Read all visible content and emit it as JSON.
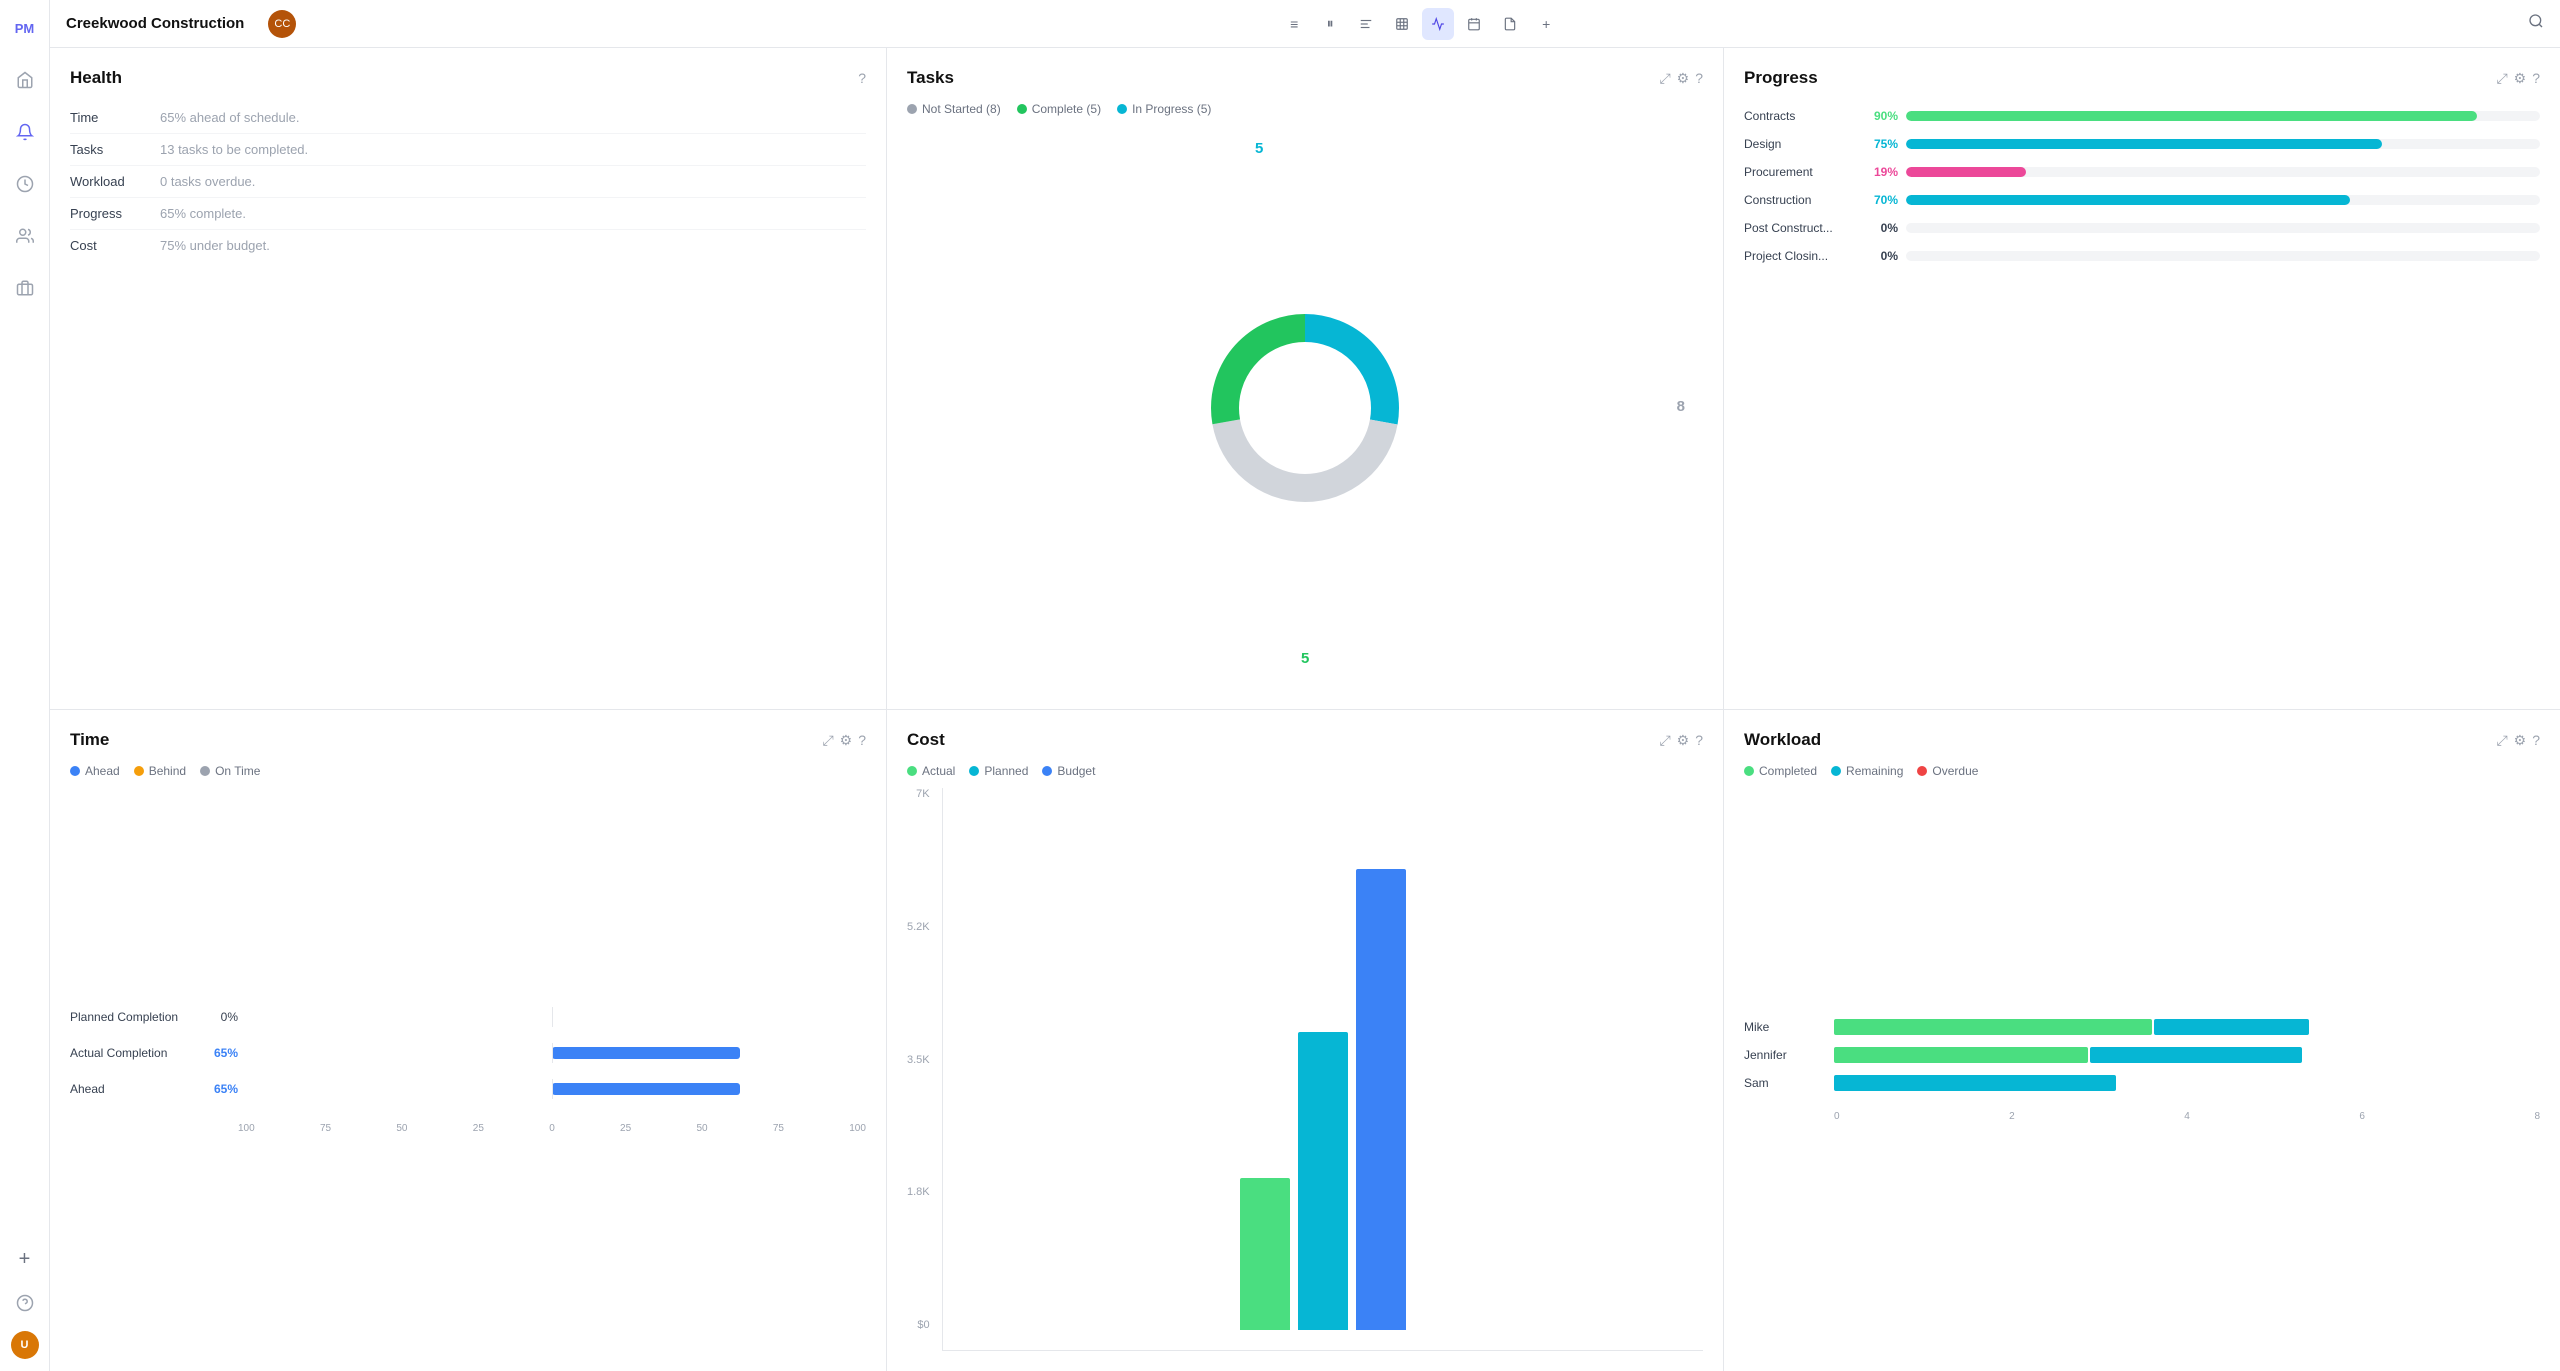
{
  "app": {
    "name": "PM",
    "project": "Creekwood Construction"
  },
  "topbar": {
    "icons": [
      {
        "label": "≡",
        "name": "list-icon",
        "active": false
      },
      {
        "label": "⏸",
        "name": "column-icon",
        "active": false
      },
      {
        "label": "≡",
        "name": "gantt-icon",
        "active": false
      },
      {
        "label": "▦",
        "name": "grid-icon",
        "active": false
      },
      {
        "label": "∿",
        "name": "dashboard-icon",
        "active": true
      },
      {
        "label": "⊞",
        "name": "calendar-icon",
        "active": false
      },
      {
        "label": "⎘",
        "name": "doc-icon",
        "active": false
      },
      {
        "label": "+",
        "name": "add-view-icon",
        "active": false
      }
    ]
  },
  "health": {
    "title": "Health",
    "rows": [
      {
        "label": "Time",
        "value": "65% ahead of schedule."
      },
      {
        "label": "Tasks",
        "value": "13 tasks to be completed."
      },
      {
        "label": "Workload",
        "value": "0 tasks overdue."
      },
      {
        "label": "Progress",
        "value": "65% complete."
      },
      {
        "label": "Cost",
        "value": "75% under budget."
      }
    ]
  },
  "tasks": {
    "title": "Tasks",
    "legend": [
      {
        "label": "Not Started (8)",
        "color": "#9ca3af"
      },
      {
        "label": "Complete (5)",
        "color": "#22c55e"
      },
      {
        "label": "In Progress (5)",
        "color": "#06b6d4"
      }
    ],
    "donut": {
      "not_started": 8,
      "complete": 5,
      "in_progress": 5,
      "label_5_top": "5",
      "label_8_right": "8",
      "label_5_bottom": "5"
    }
  },
  "progress": {
    "title": "Progress",
    "rows": [
      {
        "label": "Contracts",
        "pct": 90,
        "pct_label": "90%",
        "color": "#4ade80"
      },
      {
        "label": "Design",
        "pct": 75,
        "pct_label": "75%",
        "color": "#06b6d4"
      },
      {
        "label": "Procurement",
        "pct": 19,
        "pct_label": "19%",
        "color": "#ec4899"
      },
      {
        "label": "Construction",
        "pct": 70,
        "pct_label": "70%",
        "color": "#06b6d4"
      },
      {
        "label": "Post Construct...",
        "pct": 0,
        "pct_label": "0%",
        "color": "#06b6d4"
      },
      {
        "label": "Project Closin...",
        "pct": 0,
        "pct_label": "0%",
        "color": "#06b6d4"
      }
    ]
  },
  "time": {
    "title": "Time",
    "legend": [
      {
        "label": "Ahead",
        "color": "#3b82f6"
      },
      {
        "label": "Behind",
        "color": "#f59e0b"
      },
      {
        "label": "On Time",
        "color": "#9ca3af"
      }
    ],
    "rows": [
      {
        "label": "Planned Completion",
        "pct_label": "0%",
        "pct": 0,
        "show_bar": false
      },
      {
        "label": "Actual Completion",
        "pct_label": "65%",
        "pct": 65,
        "show_bar": true
      },
      {
        "label": "Ahead",
        "pct_label": "65%",
        "pct": 65,
        "show_bar": true
      }
    ],
    "axis": [
      "100",
      "75",
      "50",
      "25",
      "0",
      "25",
      "50",
      "75",
      "100"
    ]
  },
  "cost": {
    "title": "Cost",
    "legend": [
      {
        "label": "Actual",
        "color": "#4ade80"
      },
      {
        "label": "Planned",
        "color": "#06b6d4"
      },
      {
        "label": "Budget",
        "color": "#3b82f6"
      }
    ],
    "y_labels": [
      "7K",
      "5.2K",
      "3.5K",
      "1.8K",
      "$0"
    ],
    "bars": [
      {
        "label": "Actual",
        "color": "#4ade80",
        "height_pct": 28
      },
      {
        "label": "Planned",
        "color": "#06b6d4",
        "height_pct": 55
      },
      {
        "label": "Budget",
        "color": "#3b82f6",
        "height_pct": 85
      }
    ]
  },
  "workload": {
    "title": "Workload",
    "legend": [
      {
        "label": "Completed",
        "color": "#4ade80"
      },
      {
        "label": "Remaining",
        "color": "#06b6d4"
      },
      {
        "label": "Overdue",
        "color": "#ef4444"
      }
    ],
    "rows": [
      {
        "label": "Mike",
        "completed": 3,
        "remaining": 1.5,
        "overdue": 0
      },
      {
        "label": "Jennifer",
        "completed": 2.5,
        "remaining": 2,
        "overdue": 0
      },
      {
        "label": "Sam",
        "completed": 0,
        "remaining": 3,
        "overdue": 0
      }
    ],
    "axis": [
      "0",
      "2",
      "4",
      "6",
      "8"
    ]
  }
}
